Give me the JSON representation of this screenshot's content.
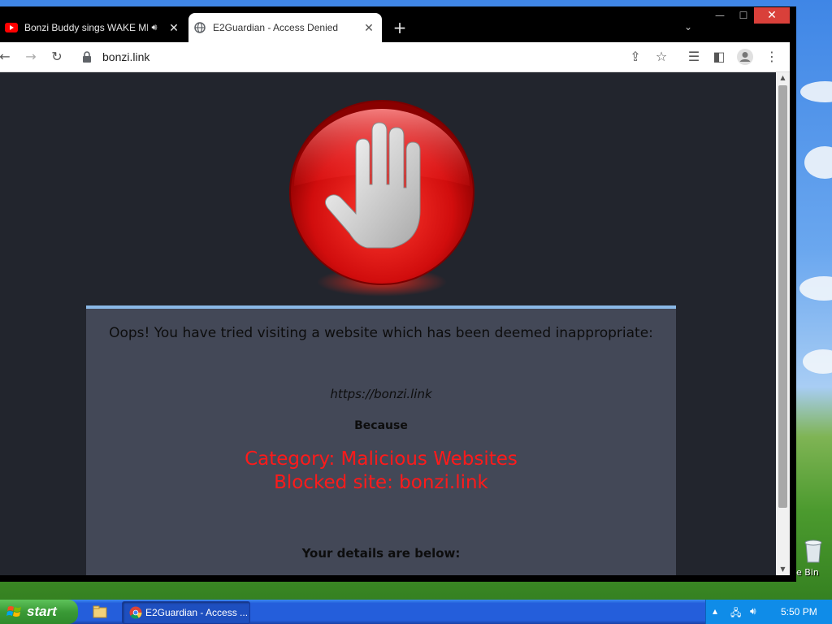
{
  "browser": {
    "tabs": [
      {
        "title": "Bonzi Buddy sings WAKE ME UP",
        "favicon": "youtube-icon",
        "audio": "speaker-icon",
        "active": false
      },
      {
        "title": "E2Guardian - Access Denied",
        "favicon": "globe-icon",
        "active": true
      }
    ],
    "new_tab": "+",
    "address": "bonzi.link",
    "window_controls": {
      "minimize": "—",
      "maximize": "☐",
      "close": "✕"
    }
  },
  "page": {
    "heading": "Oops! You have tried visiting a website which has been deemed inappropriate:",
    "blocked_url": "https://bonzi.link",
    "because": "Because",
    "category": "Category: Malicious Websites",
    "blocked_site": "Blocked site: bonzi.link",
    "details": "Your details are below:"
  },
  "desktop": {
    "recycle_label": "e Bin"
  },
  "taskbar": {
    "start_label": "start",
    "task_button_label": "E2Guardian - Access ...",
    "clock": "5:50 PM"
  },
  "colors": {
    "accent_red": "#ff1a1a",
    "page_bg": "#22252d",
    "card_bg": "#434857",
    "taskbar_blue": "#245edb",
    "start_green": "#3a9a36"
  }
}
